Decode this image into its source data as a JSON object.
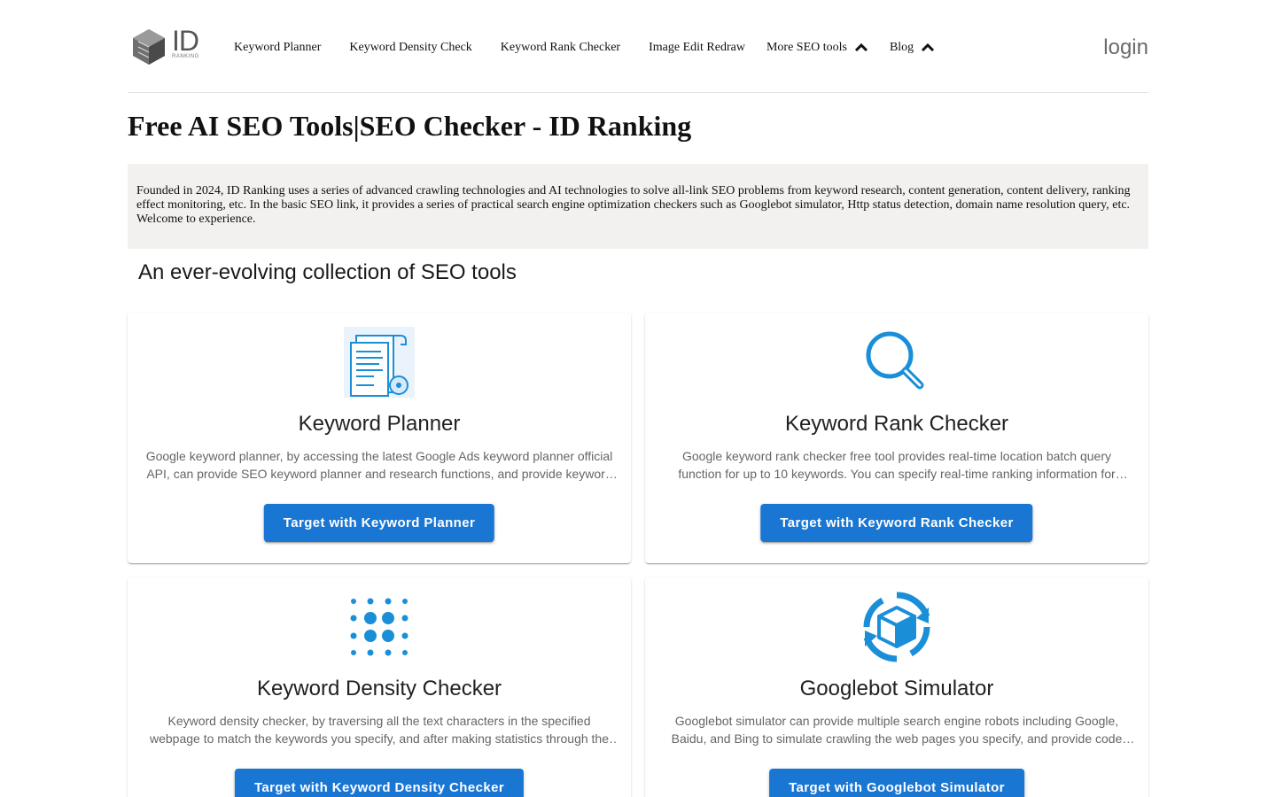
{
  "brand": {
    "logo_text": "ID",
    "logo_sub": "RANKING"
  },
  "nav": {
    "items": [
      {
        "label": "Keyword Planner"
      },
      {
        "label": "Keyword Density Check"
      },
      {
        "label": "Keyword Rank Checker"
      },
      {
        "label": "Image Edit Redraw"
      },
      {
        "label": "More SEO tools"
      },
      {
        "label": "Blog"
      }
    ],
    "login_label": "login"
  },
  "page": {
    "title": "Free AI SEO Tools|SEO Checker - ID Ranking",
    "intro": "Founded in 2024, ID Ranking uses a series of advanced crawling technologies and AI technologies to solve all-link SEO problems from keyword research, content generation, content delivery, ranking effect monitoring, etc. In the basic SEO link, it provides a series of practical search engine optimization checkers such as Googlebot simulator, Http status detection, domain name resolution query, etc. Welcome to experience.",
    "section_title": "An ever-evolving collection of SEO tools"
  },
  "cards": [
    {
      "icon": "document-certificate-icon",
      "title": "Keyword Planner",
      "desc": "Google keyword planner, by accessing the latest Google Ads keyword planner official API, can provide SEO keyword planner and research functions, and provide keyword search volume and competition data.",
      "button": "Target with Keyword Planner"
    },
    {
      "icon": "magnifier-icon",
      "title": "Keyword Rank Checker",
      "desc": "Google keyword rank checker free tool provides real-time location batch query function for up to 10 keywords. You can specify real-time ranking information for keywords in any region.",
      "button": "Target with Keyword Rank Checker"
    },
    {
      "icon": "dot-grid-icon",
      "title": "Keyword Density Checker",
      "desc": "Keyword density checker, by traversing all the text characters in the specified webpage to match the keywords you specify, and after making statistics through the algorithm, gives the density result.",
      "button": "Target with Keyword Density Checker"
    },
    {
      "icon": "box-sync-icon",
      "title": "Googlebot Simulator",
      "desc": "Googlebot simulator can provide multiple search engine robots including Google, Baidu, and Bing to simulate crawling the web pages you specify, and provide code analysis results.",
      "button": "Target with Googlebot Simulator"
    }
  ],
  "colors": {
    "accent": "#1976d2",
    "icon_blue": "#1a8fd8",
    "intro_bg": "#f2f1ef"
  }
}
